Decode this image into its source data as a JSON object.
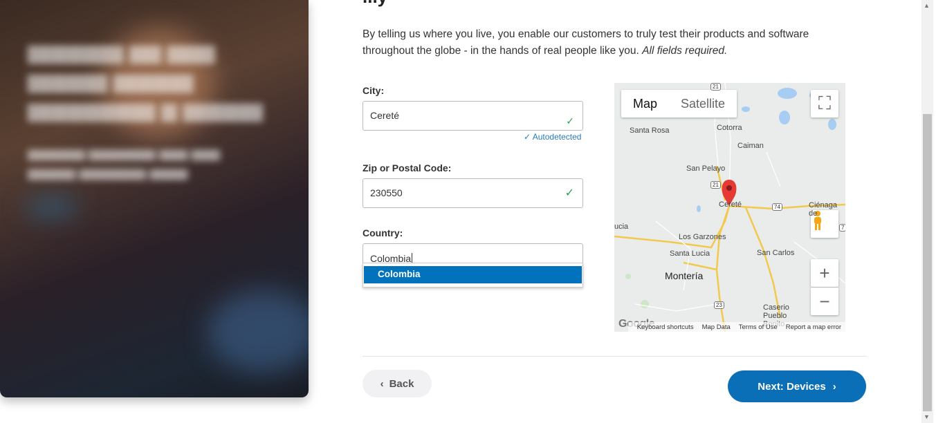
{
  "heading_partial": "...y",
  "intro": {
    "text": "By telling us where you live, you enable our customers to truly test their products and software throughout the globe - in the hands of real people like you.",
    "required_note": "All fields required."
  },
  "city": {
    "label": "City:",
    "value": "Cereté",
    "autodetected": "Autodetected"
  },
  "zip": {
    "label": "Zip or Postal Code:",
    "value": "230550"
  },
  "country": {
    "label": "Country:",
    "value": "Colombia",
    "options": [
      "Colombia"
    ]
  },
  "map": {
    "tabs": [
      "Map",
      "Satellite"
    ],
    "active_tab": "Map",
    "labels": [
      "Santa Rosa",
      "Cotorra",
      "Caiman",
      "San Pelayo",
      "Cereté",
      "Ciénaga de",
      "ucia",
      "Los Garzones",
      "Santa Lucia",
      "San Carlos",
      "Montería",
      "Caserio Pueblo Bonito"
    ],
    "road_shields": [
      "21",
      "21",
      "74",
      "7",
      "23"
    ],
    "footer": [
      "Keyboard shortcuts",
      "Map Data",
      "Terms of Use",
      "Report a map error"
    ],
    "logo": "Google"
  },
  "buttons": {
    "back": "Back",
    "next": "Next: Devices"
  }
}
